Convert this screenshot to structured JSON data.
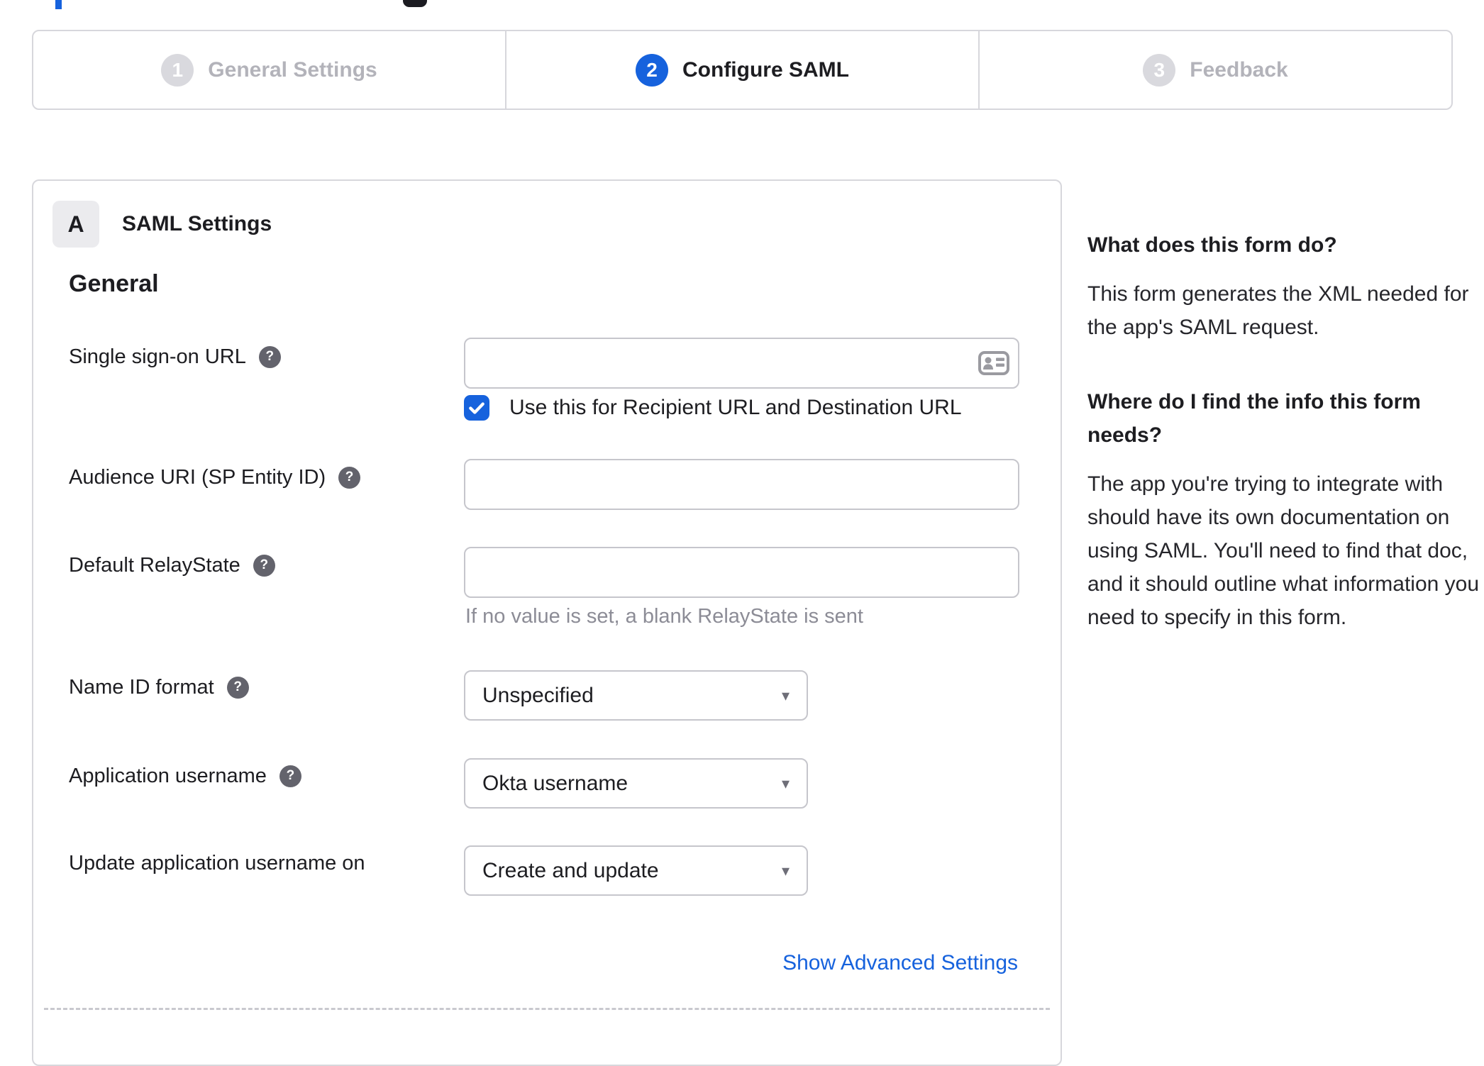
{
  "meta": {
    "accent_color": "#1662dd",
    "panel_border_color": "#d7d7dc",
    "inactive_step_circle_color": "#d9d9de",
    "inactive_step_text_color": "#b3b3ba",
    "hint_text_color": "#8c8c96"
  },
  "icons": {
    "help": "?",
    "caret": "▾",
    "check": "checkmark",
    "contact_card": "contact-card"
  },
  "stepper": {
    "active_index": 1,
    "steps": [
      {
        "number": "1",
        "label": "General Settings"
      },
      {
        "number": "2",
        "label": "Configure SAML"
      },
      {
        "number": "3",
        "label": "Feedback"
      }
    ]
  },
  "panel": {
    "badge": "A",
    "title": "SAML Settings",
    "section": "General",
    "fields": [
      {
        "label": "Single sign-on URL",
        "value": "",
        "checkbox_label": "Use this for Recipient URL and Destination URL",
        "checkbox_checked": true
      },
      {
        "label": "Audience URI (SP Entity ID)",
        "value": ""
      },
      {
        "label": "Default RelayState",
        "value": "",
        "hint": "If no value is set, a blank RelayState is sent"
      },
      {
        "label": "Name ID format",
        "value": "Unspecified"
      },
      {
        "label": "Application username",
        "value": "Okta username"
      },
      {
        "label": "Update application username on",
        "value": "Create and update"
      }
    ],
    "advanced_settings_link": "Show Advanced Settings"
  },
  "sidebar": {
    "sections": [
      {
        "heading": "What does this form do?",
        "body": "This form generates the XML needed for the app's SAML request."
      },
      {
        "heading": "Where do I find the info this form needs?",
        "body": "The app you're trying to integrate with should have its own documentation on using SAML. You'll need to find that doc, and it should outline what information you need to specify in this form."
      }
    ]
  }
}
